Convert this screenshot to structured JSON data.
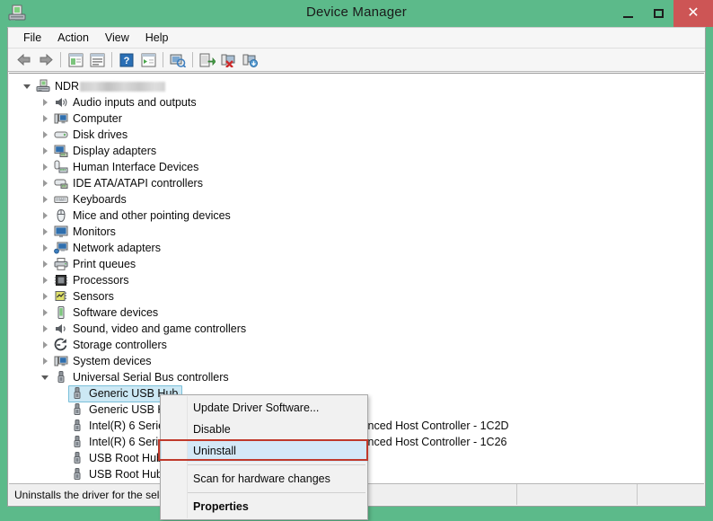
{
  "window": {
    "title": "Device Manager",
    "icon": "device-manager-icon",
    "accent_green": "#5cba8a",
    "close_red": "#cd5555",
    "controls": {
      "minimize": "–",
      "maximize": "□",
      "close": "✕"
    }
  },
  "menubar": {
    "items": [
      "File",
      "Action",
      "View",
      "Help"
    ]
  },
  "toolbar": {
    "buttons": [
      "back-icon",
      "forward-icon",
      "separator",
      "show-hide-console-tree-icon",
      "properties-icon",
      "separator",
      "help-icon",
      "show-hide-action-pane-icon",
      "separator",
      "scan-for-hardware-changes-icon",
      "separator",
      "update-driver-icon",
      "uninstall-device-icon",
      "scan-changes-icon"
    ]
  },
  "tree": {
    "root": {
      "label": "NDR",
      "redacted": true,
      "icon": "computer-icon",
      "expanded": true
    },
    "categories": [
      {
        "label": "Audio inputs and outputs",
        "icon": "speaker-icon"
      },
      {
        "label": "Computer",
        "icon": "computer-small-icon"
      },
      {
        "label": "Disk drives",
        "icon": "disk-drive-icon"
      },
      {
        "label": "Display adapters",
        "icon": "display-adapter-icon"
      },
      {
        "label": "Human Interface Devices",
        "icon": "hid-icon"
      },
      {
        "label": "IDE ATA/ATAPI controllers",
        "icon": "ide-controller-icon"
      },
      {
        "label": "Keyboards",
        "icon": "keyboard-icon"
      },
      {
        "label": "Mice and other pointing devices",
        "icon": "mouse-icon"
      },
      {
        "label": "Monitors",
        "icon": "monitor-icon"
      },
      {
        "label": "Network adapters",
        "icon": "network-adapter-icon"
      },
      {
        "label": "Print queues",
        "icon": "printer-icon"
      },
      {
        "label": "Processors",
        "icon": "processor-icon"
      },
      {
        "label": "Sensors",
        "icon": "sensor-icon"
      },
      {
        "label": "Software devices",
        "icon": "software-device-icon"
      },
      {
        "label": "Sound, video and game controllers",
        "icon": "sound-controller-icon"
      },
      {
        "label": "Storage controllers",
        "icon": "storage-controller-icon"
      },
      {
        "label": "System devices",
        "icon": "system-device-icon"
      },
      {
        "label": "Universal Serial Bus controllers",
        "icon": "usb-icon",
        "expanded": true
      }
    ],
    "usb_devices": [
      {
        "label": "Generic USB Hub",
        "icon": "usb-device-icon",
        "selected": true
      },
      {
        "label": "Generic USB Hub",
        "icon": "usb-device-icon",
        "selected": false
      },
      {
        "label": "Intel(R) 6 Series/C200 Series Chipset Family USB Enhanced Host Controller - 1C2D",
        "icon": "usb-device-icon",
        "selected": false
      },
      {
        "label": "Intel(R) 6 Series/C200 Series Chipset Family USB Enhanced Host Controller - 1C26",
        "icon": "usb-device-icon",
        "selected": false
      },
      {
        "label": "USB Root Hub",
        "icon": "usb-device-icon",
        "selected": false
      },
      {
        "label": "USB Root Hub",
        "icon": "usb-device-icon",
        "selected": false
      }
    ]
  },
  "context_menu": {
    "items": [
      {
        "label": "Update Driver Software...",
        "bold": false,
        "highlighted": false,
        "separator_after": false
      },
      {
        "label": "Disable",
        "bold": false,
        "highlighted": false,
        "separator_after": false
      },
      {
        "label": "Uninstall",
        "bold": false,
        "highlighted": true,
        "separator_after": true
      },
      {
        "label": "Scan for hardware changes",
        "bold": false,
        "highlighted": false,
        "separator_after": true
      },
      {
        "label": "Properties",
        "bold": true,
        "highlighted": false,
        "separator_after": false
      }
    ],
    "annotation_color": "#c0392b",
    "highlight_color": "#d4e8f7"
  },
  "statusbar": {
    "message": "Uninstalls the driver for the selected device.",
    "cell2": "",
    "cell3": ""
  }
}
